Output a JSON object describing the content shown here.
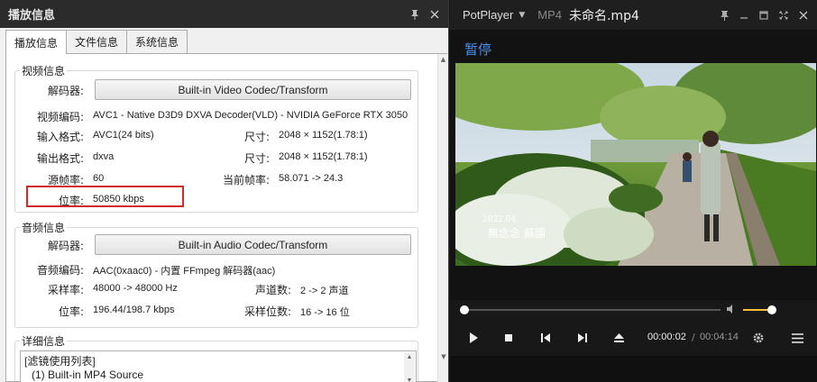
{
  "info_panel": {
    "title": "播放信息",
    "tabs": [
      "播放信息",
      "文件信息",
      "系统信息"
    ],
    "video": {
      "group_label": "视频信息",
      "decoder_label": "解码器:",
      "decoder_button": "Built-in Video Codec/Transform",
      "codec_label": "视频编码:",
      "codec_value": "AVC1 - Native D3D9 DXVA Decoder(VLD) - NVIDIA GeForce RTX 3050",
      "input_format_label": "输入格式:",
      "input_format_value": "AVC1(24 bits)",
      "input_size_label": "尺寸:",
      "input_size_value": "2048 × 1152(1.78:1)",
      "output_format_label": "输出格式:",
      "output_format_value": "dxva",
      "output_size_label": "尺寸:",
      "output_size_value": "2048 × 1152(1.78:1)",
      "source_fps_label": "源帧率:",
      "source_fps_value": "60",
      "current_fps_label": "当前帧率:",
      "current_fps_value": "58.071 -> 24.3",
      "bitrate_label": "位率:",
      "bitrate_value": "50850 kbps"
    },
    "audio": {
      "group_label": "音频信息",
      "decoder_label": "解码器:",
      "decoder_button": "Built-in Audio Codec/Transform",
      "codec_label": "音频编码:",
      "codec_value": "AAC(0xaac0) - 内置 FFmpeg 解码器(aac)",
      "sample_rate_label": "采样率:",
      "sample_rate_value": "48000 -> 48000 Hz",
      "channels_label": "声道数:",
      "channels_value": "2 -> 2 声道",
      "bitrate_label": "位率:",
      "bitrate_value": "196.44/198.7 kbps",
      "bits_label": "采样位数:",
      "bits_value": "16 -> 16 位"
    },
    "details": {
      "group_label": "详细信息",
      "lines": [
        "[滤镜使用列表]",
        "(1) Built-in MP4 Source"
      ]
    }
  },
  "player": {
    "brand": "PotPlayer",
    "format": "MP4",
    "filename": "未命名.mp4",
    "status": "暂停",
    "time_current": "00:00:02",
    "time_separator": "/",
    "time_total": "00:04:14",
    "seek_fraction": 0.008,
    "volume_fraction": 0.9,
    "video_overlay": {
      "date": "2022.04.",
      "caption": "無念念 蘇園"
    }
  },
  "colors": {
    "status_blue": "#4b8ef0",
    "accent_yellow": "#f2c23c",
    "highlight_red": "#d12a2a"
  }
}
